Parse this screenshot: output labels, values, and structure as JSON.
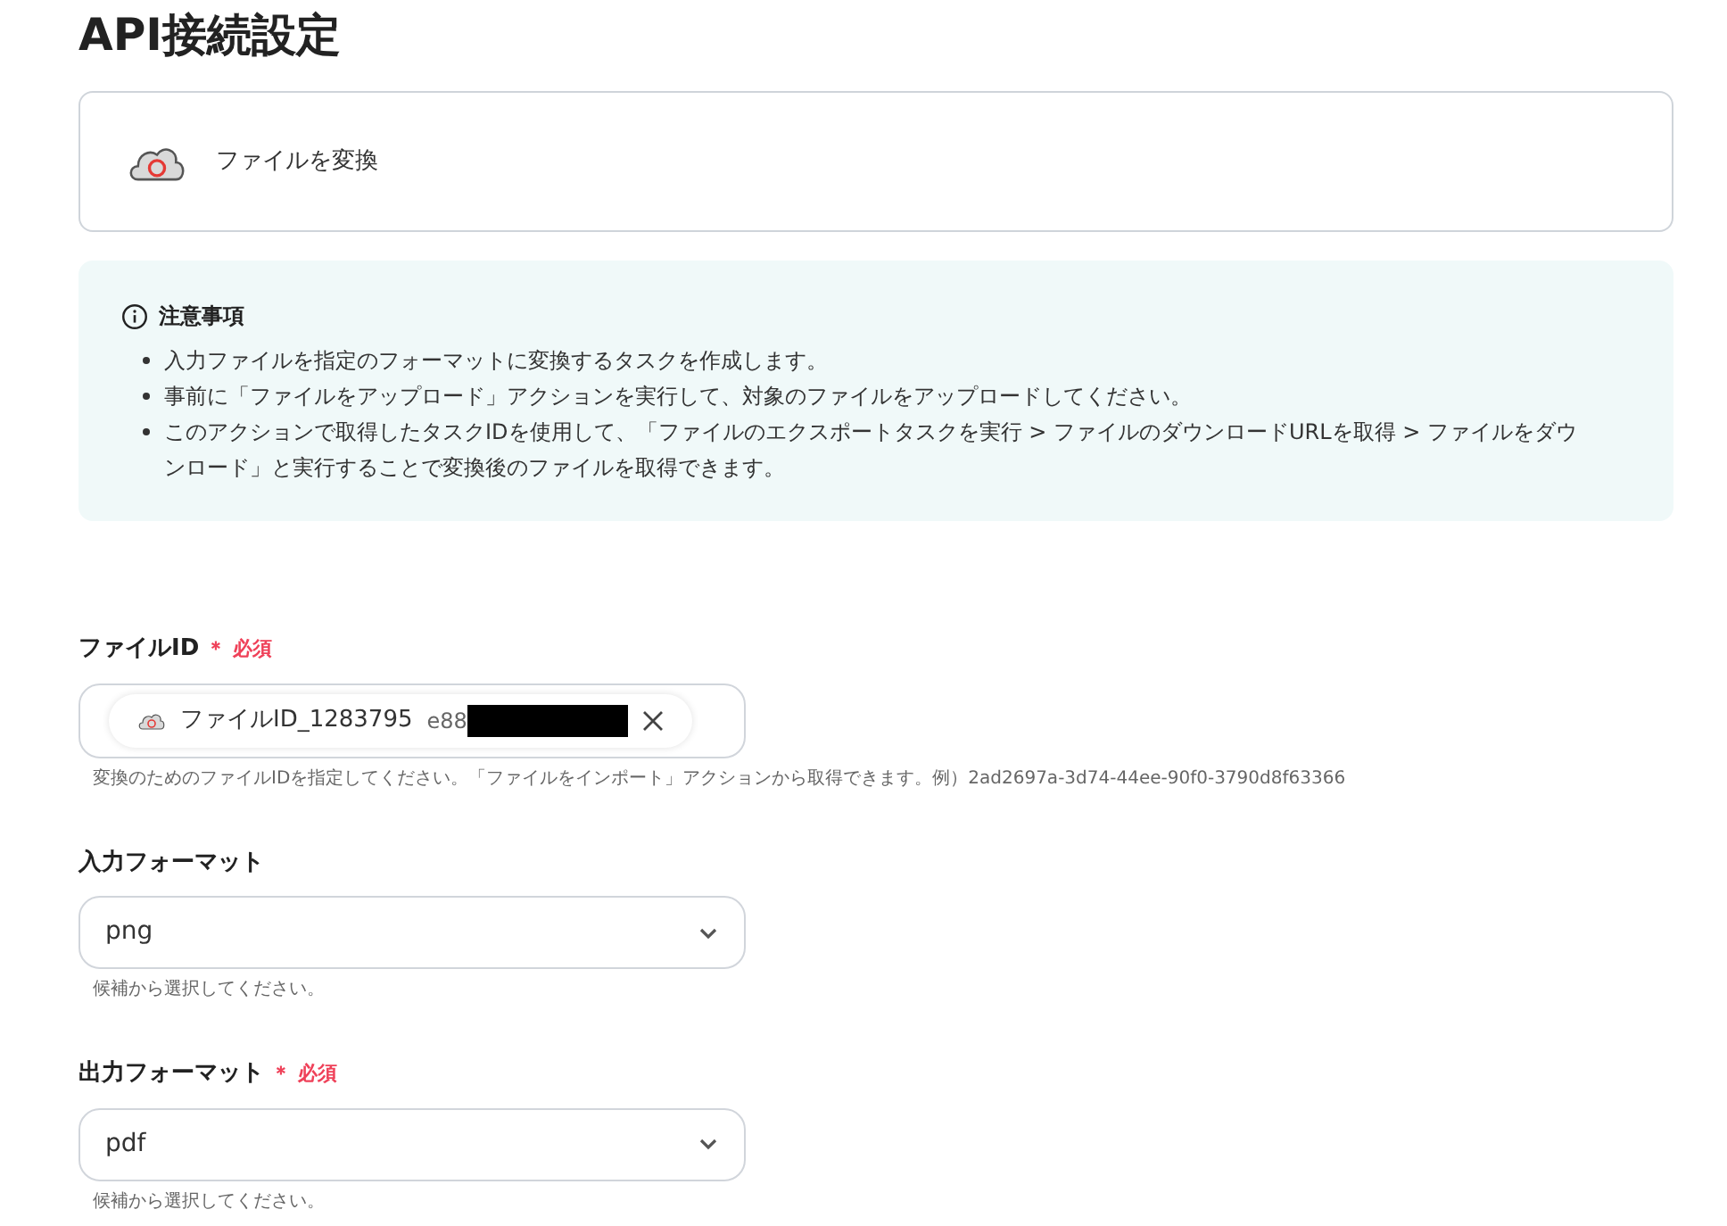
{
  "title": "API接続設定",
  "action": {
    "label": "ファイルを変換"
  },
  "notice": {
    "heading": "注意事項",
    "items": [
      "入力ファイルを指定のフォーマットに変換するタスクを作成します。",
      "事前に「ファイルをアップロード」アクションを実行して、対象のファイルをアップロードしてください。",
      "このアクションで取得したタスクIDを使用して、「ファイルのエクスポートタスクを実行 > ファイルのダウンロードURLを取得 > ファイルをダウンロード」と実行することで変換後のファイルを取得できます。"
    ]
  },
  "fields": [
    {
      "kind": "chip",
      "label": "ファイルID",
      "required": true,
      "required_label": "＊ 必須",
      "chip": {
        "name": "ファイルID_1283795",
        "id": "e88"
      },
      "help": "変換のためのファイルIDを指定してください。「ファイルをインポート」アクションから取得できます。例）2ad2697a-3d74-44ee-90f0-3790d8f63366"
    },
    {
      "kind": "select",
      "label": "入力フォーマット",
      "required": false,
      "value": "png",
      "help": "候補から選択してください。"
    },
    {
      "kind": "select",
      "label": "出力フォーマット",
      "required": true,
      "required_label": "＊ 必須",
      "value": "pdf",
      "help": "候補から選択してください。"
    }
  ]
}
